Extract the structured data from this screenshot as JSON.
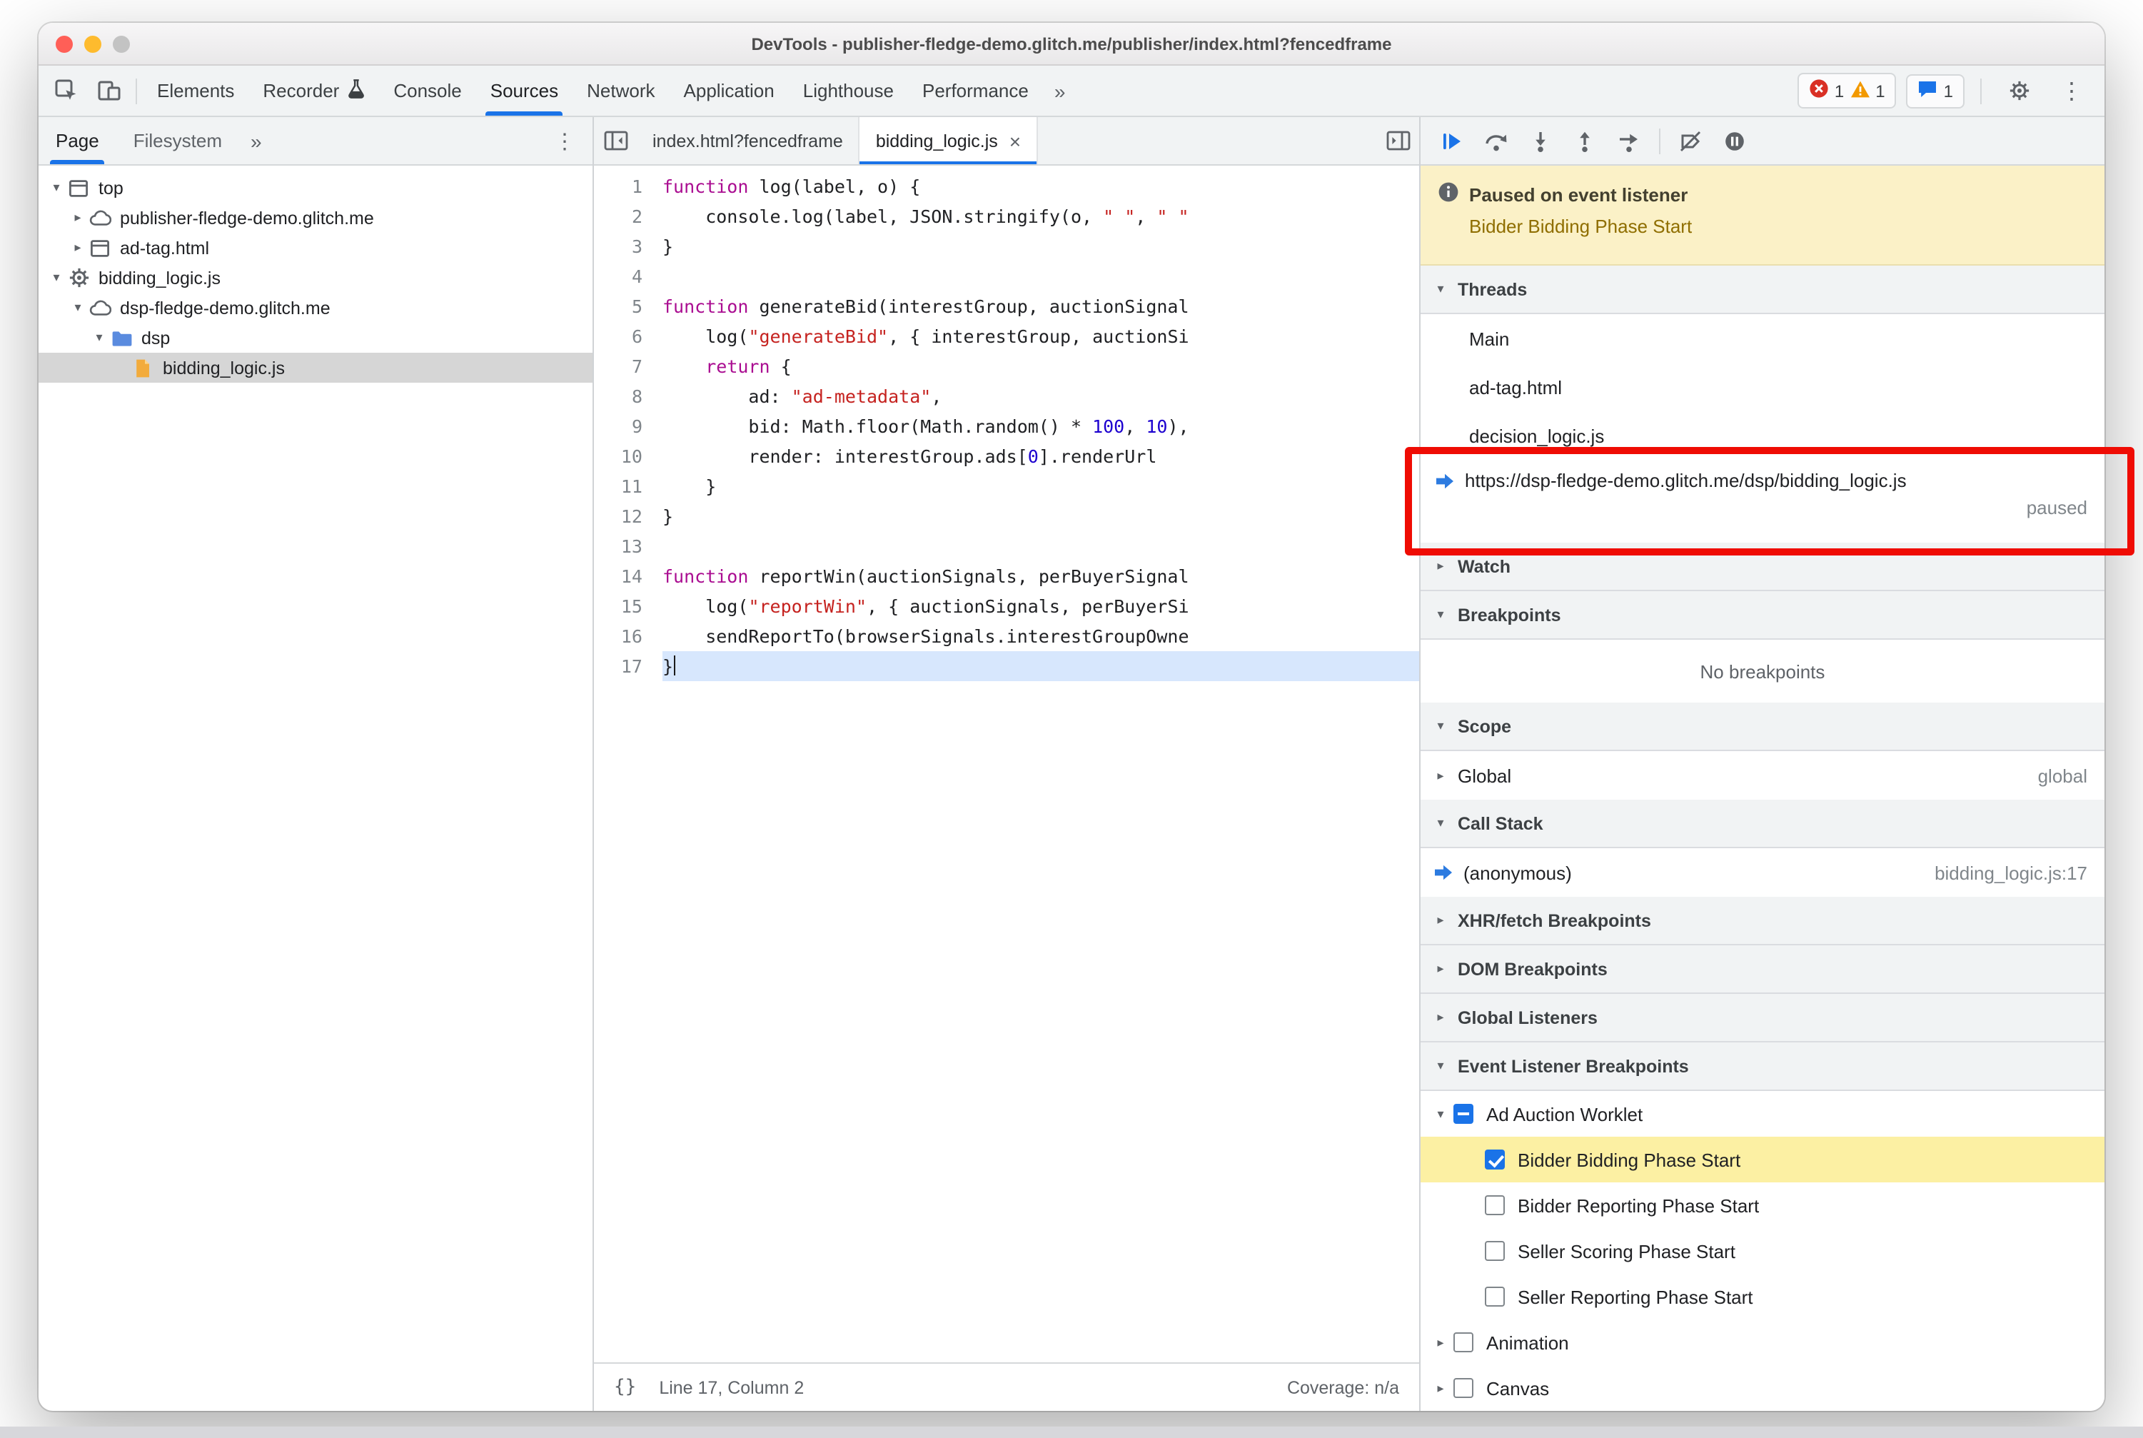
{
  "window": {
    "title": "DevTools - publisher-fledge-demo.glitch.me/publisher/index.html?fencedframe"
  },
  "main_toolbar": {
    "tabs": [
      {
        "label": "Elements",
        "selected": false
      },
      {
        "label": "Recorder",
        "selected": false,
        "icon": "flask"
      },
      {
        "label": "Console",
        "selected": false
      },
      {
        "label": "Sources",
        "selected": true
      },
      {
        "label": "Network",
        "selected": false
      },
      {
        "label": "Application",
        "selected": false
      },
      {
        "label": "Lighthouse",
        "selected": false
      },
      {
        "label": "Performance",
        "selected": false
      }
    ],
    "more_tabs": "»",
    "error_count": "1",
    "warning_count": "1",
    "issue_count": "1"
  },
  "sidebar": {
    "tabs": [
      {
        "label": "Page",
        "selected": true
      },
      {
        "label": "Filesystem",
        "selected": false
      }
    ],
    "more_tabs": "»",
    "tree": [
      {
        "depth": 0,
        "arrow": "open",
        "icon": "frame",
        "label": "top"
      },
      {
        "depth": 1,
        "arrow": "closed",
        "icon": "cloud",
        "label": "publisher-fledge-demo.glitch.me"
      },
      {
        "depth": 1,
        "arrow": "closed",
        "icon": "frame",
        "label": "ad-tag.html"
      },
      {
        "depth": 0,
        "arrow": "open",
        "icon": "gear",
        "label": "bidding_logic.js"
      },
      {
        "depth": 1,
        "arrow": "open",
        "icon": "cloud",
        "label": "dsp-fledge-demo.glitch.me"
      },
      {
        "depth": 2,
        "arrow": "open",
        "icon": "folder",
        "label": "dsp"
      },
      {
        "depth": 3,
        "arrow": "none",
        "icon": "file",
        "label": "bidding_logic.js",
        "selected": true
      }
    ]
  },
  "editor": {
    "tabs": [
      {
        "label": "index.html?fencedframe",
        "active": false
      },
      {
        "label": "bidding_logic.js",
        "active": true,
        "close": "×"
      }
    ],
    "lines": [
      {
        "n": 1,
        "tokens": [
          [
            "kw",
            "function"
          ],
          [
            "pl",
            " log(label, o) {"
          ]
        ]
      },
      {
        "n": 2,
        "tokens": [
          [
            "pl",
            "    console.log(label, JSON.stringify(o, "
          ],
          [
            "str",
            "\" \""
          ],
          [
            "pl",
            ", "
          ],
          [
            "str",
            "\" \""
          ]
        ]
      },
      {
        "n": 3,
        "tokens": [
          [
            "pl",
            "}"
          ]
        ]
      },
      {
        "n": 4,
        "tokens": []
      },
      {
        "n": 5,
        "tokens": [
          [
            "kw",
            "function"
          ],
          [
            "pl",
            " generateBid(interestGroup, auctionSignal"
          ]
        ]
      },
      {
        "n": 6,
        "tokens": [
          [
            "pl",
            "    log("
          ],
          [
            "str",
            "\"generateBid\""
          ],
          [
            "pl",
            ", { interestGroup, auctionSi"
          ]
        ]
      },
      {
        "n": 7,
        "tokens": [
          [
            "pl",
            "    "
          ],
          [
            "kw",
            "return"
          ],
          [
            "pl",
            " {"
          ]
        ]
      },
      {
        "n": 8,
        "tokens": [
          [
            "pl",
            "        ad: "
          ],
          [
            "str",
            "\"ad-metadata\""
          ],
          [
            "pl",
            ","
          ]
        ]
      },
      {
        "n": 9,
        "tokens": [
          [
            "pl",
            "        bid: Math.floor(Math.random() * "
          ],
          [
            "num",
            "100"
          ],
          [
            "pl",
            ", "
          ],
          [
            "num",
            "10"
          ],
          [
            "pl",
            "),"
          ]
        ]
      },
      {
        "n": 10,
        "tokens": [
          [
            "pl",
            "        render: interestGroup.ads["
          ],
          [
            "num",
            "0"
          ],
          [
            "pl",
            "].renderUrl"
          ]
        ]
      },
      {
        "n": 11,
        "tokens": [
          [
            "pl",
            "    }"
          ]
        ]
      },
      {
        "n": 12,
        "tokens": [
          [
            "pl",
            "}"
          ]
        ]
      },
      {
        "n": 13,
        "tokens": []
      },
      {
        "n": 14,
        "tokens": [
          [
            "kw",
            "function"
          ],
          [
            "pl",
            " reportWin(auctionSignals, perBuyerSignal"
          ]
        ]
      },
      {
        "n": 15,
        "tokens": [
          [
            "pl",
            "    log("
          ],
          [
            "str",
            "\"reportWin\""
          ],
          [
            "pl",
            ", { auctionSignals, perBuyerSi"
          ]
        ]
      },
      {
        "n": 16,
        "tokens": [
          [
            "pl",
            "    sendReportTo(browserSignals.interestGroupOwne"
          ]
        ]
      },
      {
        "n": 17,
        "tokens": [
          [
            "pl",
            "}"
          ]
        ],
        "highlight": true,
        "caret": true
      }
    ],
    "status": {
      "pretty_print": "{}",
      "position": "Line 17, Column 2",
      "coverage": "Coverage: n/a"
    }
  },
  "debugger": {
    "toolbar": [
      "resume",
      "step-over",
      "step-into",
      "step-out",
      "step",
      "deactivate-breakpoints",
      "pause-exceptions"
    ],
    "paused_banner": {
      "title": "Paused on event listener",
      "reason": "Bidder Bidding Phase Start"
    },
    "threads": {
      "title": "Threads",
      "items": [
        {
          "label": "Main"
        },
        {
          "label": "ad-tag.html"
        },
        {
          "label": "decision_logic.js"
        },
        {
          "label": "https://dsp-fledge-demo.glitch.me/dsp/bidding_logic.js",
          "active": true,
          "status": "paused"
        }
      ]
    },
    "watch": {
      "title": "Watch"
    },
    "breakpoints": {
      "title": "Breakpoints",
      "empty_text": "No breakpoints"
    },
    "scope": {
      "title": "Scope",
      "rows": [
        {
          "label": "Global",
          "value": "global"
        }
      ]
    },
    "call_stack": {
      "title": "Call Stack",
      "rows": [
        {
          "label": "(anonymous)",
          "location": "bidding_logic.js:17",
          "active": true
        }
      ]
    },
    "xhr_breakpoints": {
      "title": "XHR/fetch Breakpoints"
    },
    "dom_breakpoints": {
      "title": "DOM Breakpoints"
    },
    "global_listeners": {
      "title": "Global Listeners"
    },
    "event_listener_breakpoints": {
      "title": "Event Listener Breakpoints",
      "items": [
        {
          "depth": 0,
          "arrow": "open",
          "checkbox": "indeterminate",
          "label": "Ad Auction Worklet"
        },
        {
          "depth": 1,
          "arrow": "none",
          "checkbox": "checked",
          "label": "Bidder Bidding Phase Start",
          "highlight": true
        },
        {
          "depth": 1,
          "arrow": "none",
          "checkbox": "unchecked",
          "label": "Bidder Reporting Phase Start"
        },
        {
          "depth": 1,
          "arrow": "none",
          "checkbox": "unchecked",
          "label": "Seller Scoring Phase Start"
        },
        {
          "depth": 1,
          "arrow": "none",
          "checkbox": "unchecked",
          "label": "Seller Reporting Phase Start"
        },
        {
          "depth": 0,
          "arrow": "closed",
          "checkbox": "unchecked",
          "label": "Animation"
        },
        {
          "depth": 0,
          "arrow": "closed",
          "checkbox": "unchecked",
          "label": "Canvas"
        }
      ]
    },
    "colors": {
      "accent": "#1a73e8",
      "paused_banner_bg": "#fbf1c7",
      "annotation_red": "#ef0c04",
      "highlight_yellow": "#fcf0a3"
    }
  }
}
